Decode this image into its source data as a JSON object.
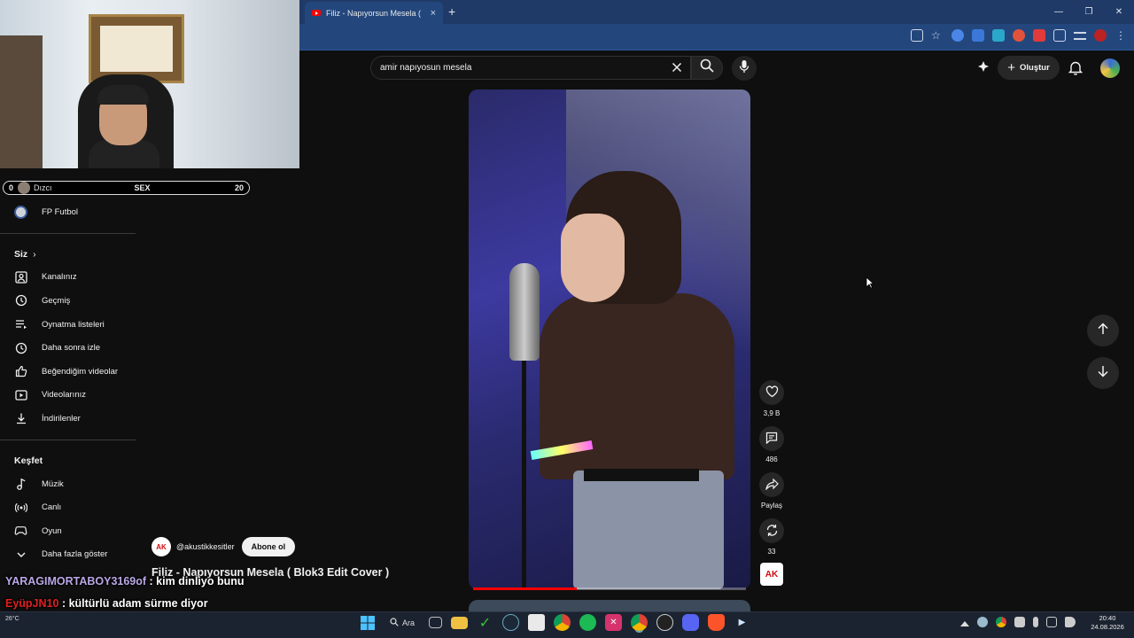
{
  "browser": {
    "tab_title": "Filiz - Napıyorsun Mesela (",
    "tab_close": "×",
    "new_tab": "+",
    "window_controls": [
      "—",
      "❐",
      "✕"
    ]
  },
  "overlay_bar": {
    "left_num": "0",
    "label": "Dızcı",
    "center": "SEX",
    "right_num": "20"
  },
  "sidebar": {
    "top_item": {
      "label": "FP Futbol",
      "icon": "channel-avatar"
    },
    "siz_heading": "Siz",
    "siz_items": [
      {
        "label": "Kanalınız",
        "icon": "person-icon"
      },
      {
        "label": "Geçmiş",
        "icon": "history-icon"
      },
      {
        "label": "Oynatma listeleri",
        "icon": "playlist-icon"
      },
      {
        "label": "Daha sonra izle",
        "icon": "clock-icon"
      },
      {
        "label": "Beğendiğim videolar",
        "icon": "thumbs-up-icon"
      },
      {
        "label": "Videolarınız",
        "icon": "video-icon"
      },
      {
        "label": "İndirilenler",
        "icon": "download-icon"
      }
    ],
    "kesfet_heading": "Keşfet",
    "kesfet_items": [
      {
        "label": "Müzik",
        "icon": "music-icon"
      },
      {
        "label": "Canlı",
        "icon": "live-icon"
      },
      {
        "label": "Oyun",
        "icon": "gaming-icon"
      },
      {
        "label": "Daha fazla göster",
        "icon": "chevron-down-icon"
      }
    ]
  },
  "header": {
    "search_value": "amir napıyosun mesela",
    "create_label": "Oluştur"
  },
  "video": {
    "progress": 0.38,
    "channel_logo": "AK",
    "channel_handle": "@akustikkesitler",
    "subscribe_label": "Abone ol",
    "title": "Filiz - Napıyorsun Mesela ( Blok3 Edit Cover )"
  },
  "actions": {
    "likes": "3,9 B",
    "comments": "486",
    "share": "Paylaş",
    "remix": "33"
  },
  "chat": [
    {
      "user": "YARAGIMORTABOY3169of",
      "message": ": kim dinliyo bunu"
    },
    {
      "user": "EyüpJN10",
      "message": ": kültürlü adam sürme diyor"
    }
  ],
  "taskbar": {
    "temp": "26°C",
    "search_label": "Ara",
    "time": "20:40",
    "date": "24.08.2026"
  },
  "colors": {
    "background": "#0f0f0f",
    "browser_chrome": "#23477d",
    "progress_red": "#ff0000",
    "chat_user1": "#b9a8e6",
    "chat_user2": "#e02020"
  }
}
